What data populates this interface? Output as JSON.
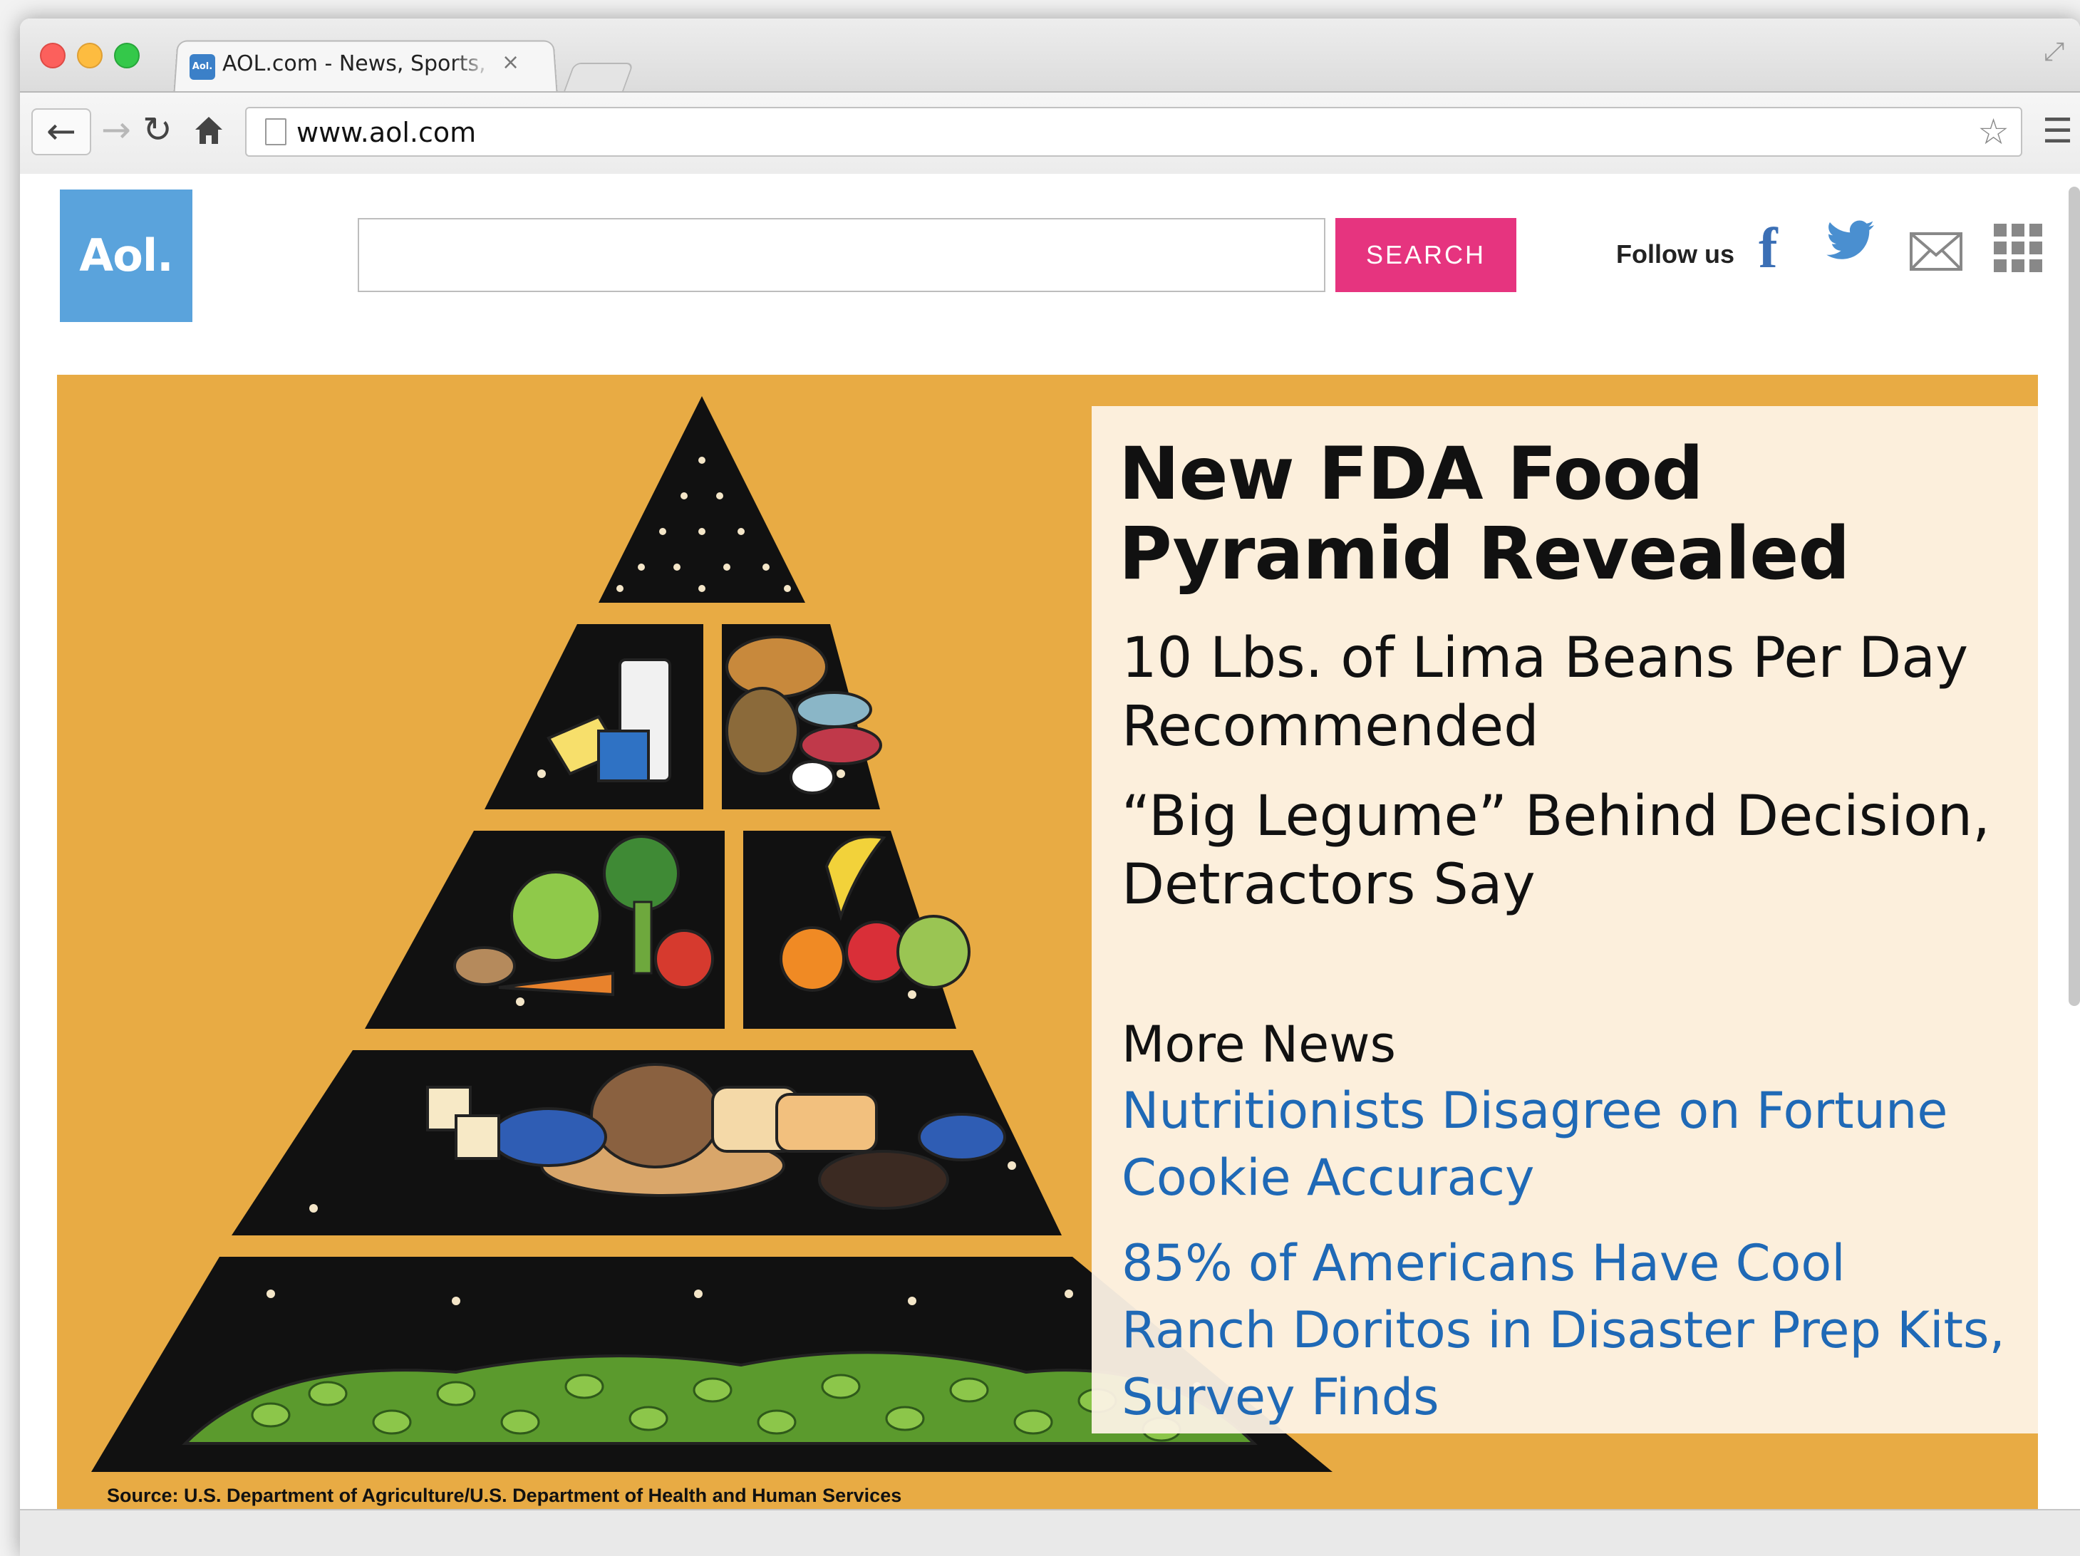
{
  "browser": {
    "tab_title": "AOL.com - News, Sports, Weather",
    "tab_favicon_text": "Aol.",
    "url": "www.aol.com",
    "close_glyph": "×"
  },
  "header": {
    "logo_text": "Aol.",
    "search_placeholder": "",
    "search_button": "SEARCH",
    "follow_label": "Follow us",
    "social_icons": [
      "facebook-icon",
      "twitter-icon",
      "mail-icon",
      "apps-grid-icon"
    ]
  },
  "hero": {
    "headline": "New FDA Food Pyramid Revealed",
    "subheads": [
      "10 Lbs. of Lima Beans Per Day Recommended",
      "“Big Legume” Behind Decision, Detractors Say"
    ],
    "more_news_label": "More News",
    "links": [
      "Nutritionists Disagree on Fortune Cookie Accuracy",
      "85% of Americans Have Cool Ranch Doritos in Disaster Prep Kits, Survey Finds"
    ],
    "source": "Source: U.S. Department of Agriculture/U.S. Department of Health and Human Services"
  },
  "colors": {
    "aol_blue": "#5aa3dc",
    "search_pink": "#e6347f",
    "hero_orange": "#e8ab44",
    "link_blue": "#1f69b6",
    "panel_cream": "#fdf3e6"
  }
}
